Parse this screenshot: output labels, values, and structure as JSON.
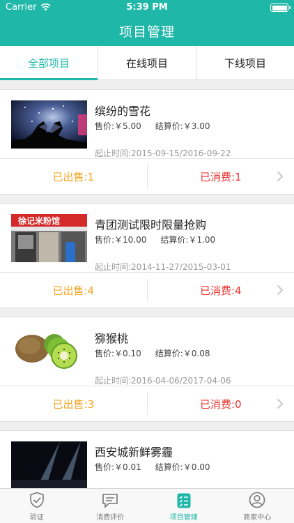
{
  "status": {
    "carrier": "Carrier",
    "time": "5:39 PM"
  },
  "nav": {
    "title": "项目管理"
  },
  "tabs": [
    {
      "label": "全部项目",
      "active": true
    },
    {
      "label": "在线项目",
      "active": false
    },
    {
      "label": "下线项目",
      "active": false
    }
  ],
  "items": [
    {
      "name": "缤纷的雪花",
      "price": "售价:￥5.00",
      "settle": "结算价:￥3.00",
      "dates": "起止时间:2015-09-15/2016-09-22",
      "sold": "已出售:1",
      "consumed": "已消费:1",
      "thumb_icon": "concert-hands-image"
    },
    {
      "name": "青团测试限时限量抢购",
      "price": "售价:￥10.00",
      "settle": "结算价:￥1.00",
      "dates": "起止时间:2014-11-27/2015-03-01",
      "sold": "已出售:4",
      "consumed": "已消费:4",
      "thumb_icon": "storefront-image",
      "thumb_sign": "徐记米粉馆"
    },
    {
      "name": "猕猴桃",
      "price": "售价:￥0.10",
      "settle": "结算价:￥0.08",
      "dates": "起止时间:2016-04-06/2017-04-06",
      "sold": "已出售:3",
      "consumed": "已消费:0",
      "thumb_icon": "kiwi-image"
    },
    {
      "name": "西安城新鲜雾霾",
      "price": "售价:￥0.01",
      "settle": "结算价:￥0.00",
      "dates": "",
      "sold": "",
      "consumed": "",
      "thumb_icon": "stage-lights-image"
    }
  ],
  "tabbar": [
    {
      "label": "验证",
      "icon": "shield-check-icon",
      "active": false
    },
    {
      "label": "消费评价",
      "icon": "comment-icon",
      "active": false
    },
    {
      "label": "项目管理",
      "icon": "checklist-icon",
      "active": true
    },
    {
      "label": "商家中心",
      "icon": "user-circle-icon",
      "active": false
    }
  ],
  "colors": {
    "accent": "#1fb7a8",
    "sold": "#f3a521",
    "consumed": "#e8302d"
  }
}
